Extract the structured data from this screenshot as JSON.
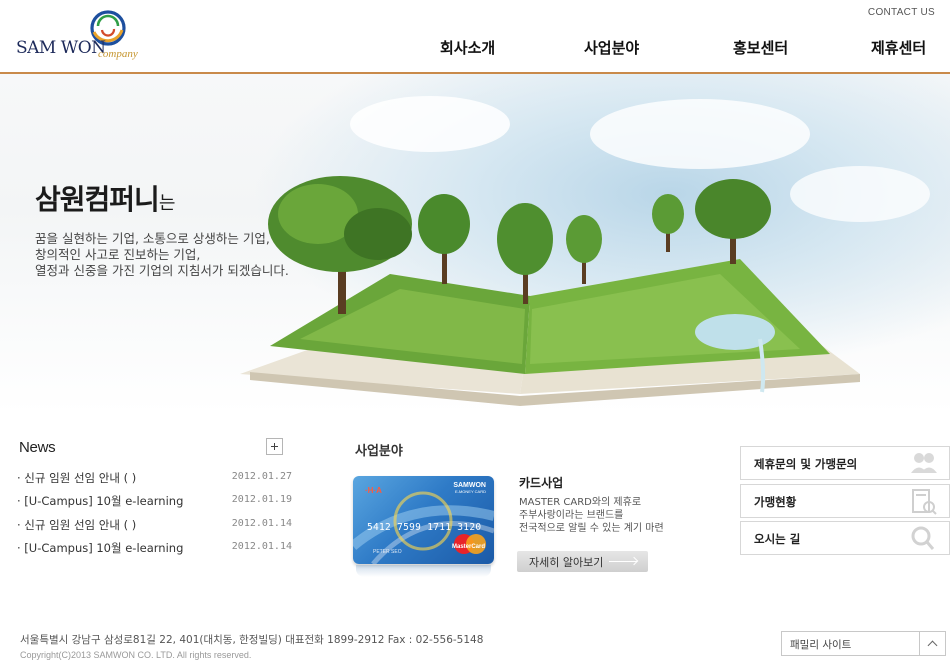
{
  "header": {
    "logo_text": "SAM WON",
    "logo_sub": "company",
    "contact_link": "CONTACT US",
    "nav": [
      "회사소개",
      "사업분야",
      "홍보센터",
      "제휴센터"
    ]
  },
  "hero": {
    "title_main": "삼원컴퍼니",
    "title_suffix": "는",
    "lines": [
      "꿈을 실현하는 기업, 소통으로 상생하는 기업,",
      "창의적인 사고로 진보하는 기업,",
      "열정과 신중을 가진 기업의 지침서가 되겠습니다."
    ]
  },
  "news": {
    "title": "News",
    "items": [
      {
        "title": "· 신규 임원 선임 안내 ( )",
        "date": "2012.01.27"
      },
      {
        "title": "· [U-Campus] 10월 e-learning",
        "date": "2012.01.19"
      },
      {
        "title": "· 신규 임원 선임 안내 ( )",
        "date": "2012.01.14"
      },
      {
        "title": "· [U-Campus] 10월 e-learning",
        "date": "2012.01.14"
      }
    ]
  },
  "business": {
    "title": "사업분야",
    "card_brand": "SAMWON",
    "card_brand_sub": "E-MONEY CARD",
    "card_number": "5412  7599  1711  3120",
    "card_holder": "PETER SEO",
    "card_network": "MasterCard",
    "name": "카드사업",
    "desc": [
      "MASTER CARD와의 제휴로",
      "주부사랑이라는 브랜드를",
      "전국적으로 알릴 수 있는 계기 마련"
    ],
    "more_label": "자세히 알아보기"
  },
  "quick_links": [
    {
      "label": "제휴문의 및 가맹문의",
      "icon": "people-icon"
    },
    {
      "label": "가맹현황",
      "icon": "store-search-icon"
    },
    {
      "label": "오시는 길",
      "icon": "magnifier-icon"
    }
  ],
  "footer": {
    "address": "서울특별시 강남구 삼성로81길 22, 401(대치동, 한정빌딩)  대표전화 1899-2912  Fax : 02-556-5148",
    "copyright": "Copyright(C)2013 SAMWON CO. LTD.  All rights reserved.",
    "family_site_label": "패밀리 사이트"
  },
  "colors": {
    "header_rule": "#c98a4a",
    "logo_navy": "#1d2a5a",
    "logo_gold": "#c6962f",
    "card_blue": "#2f7bc7"
  }
}
